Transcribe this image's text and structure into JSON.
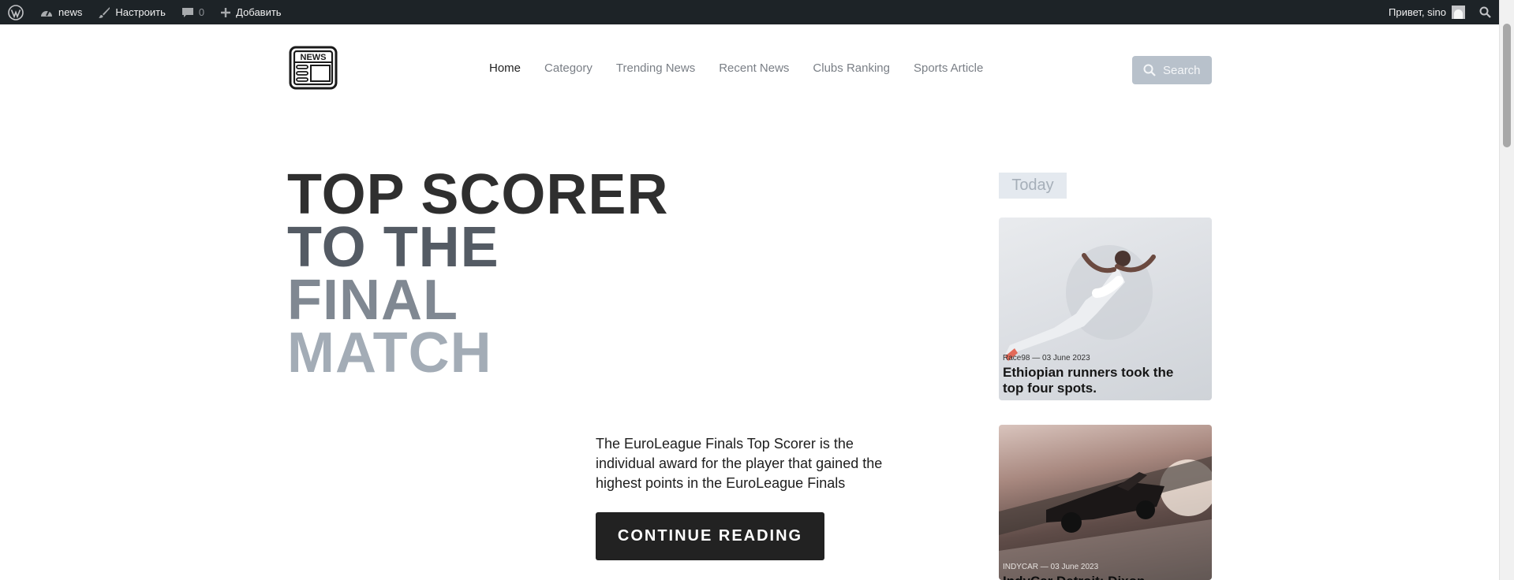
{
  "adminbar": {
    "items": [
      {
        "icon": "wordpress-logo-icon"
      },
      {
        "icon": "dashboard-icon",
        "label": "news"
      },
      {
        "icon": "brush-icon",
        "label": "Настроить"
      },
      {
        "icon": "comment-icon",
        "count": "0"
      },
      {
        "icon": "plus-icon",
        "label": "Добавить"
      }
    ],
    "greeting": "Привет, sino"
  },
  "header": {
    "logo_text": "NEWS",
    "nav": [
      "Home",
      "Category",
      "Trending News",
      "Recent News",
      "Clubs Ranking",
      "Sports Article"
    ],
    "active_nav": "Home",
    "search_label": "Search"
  },
  "hero": {
    "title_lines": [
      "TOP SCORER",
      "TO THE",
      "FINAL",
      "MATCH"
    ],
    "excerpt": "The EuroLeague Finals Top Scorer is the individual award for the player that gained the highest points in the EuroLeague Finals",
    "cta": "CONTINUE READING"
  },
  "sidebar": {
    "today_label": "Today",
    "cards": [
      {
        "meta": "Race98 — 03 June 2023",
        "title": "Ethiopian runners took the top four spots."
      },
      {
        "meta": "INDYCAR — 03 June 2023",
        "title": "IndyCar Detroit: Dixon quickest in first practice"
      }
    ]
  },
  "colors": {
    "adminbar_bg": "#1d2327",
    "cta_bg": "#222222",
    "search_bg": "#b8c1cb",
    "today_bg": "#e4e9ef"
  }
}
